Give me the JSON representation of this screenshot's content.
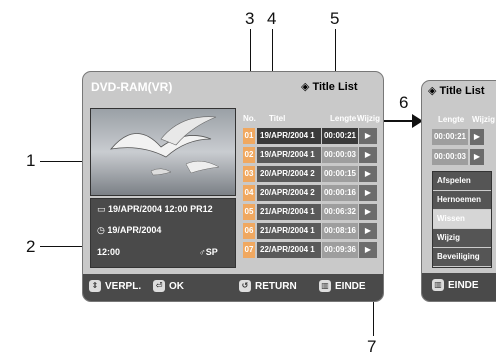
{
  "callouts": {
    "c1": "1",
    "c2": "2",
    "c3": "3",
    "c4": "4",
    "c5": "5",
    "c6": "6",
    "c7": "7"
  },
  "panel": {
    "title": "DVD-RAM(VR)",
    "title_list_label": "Title List",
    "columns": {
      "no": "No.",
      "titel": "Titel",
      "lengte": "Lengte",
      "wijzig": "Wijzig"
    },
    "info": {
      "line1": "19/APR/2004 12:00 PR12",
      "line2": "19/APR/2004",
      "line3_time": "12:00",
      "line3_mode": "SP"
    },
    "rows": [
      {
        "num": "01",
        "title": "19/APR/2004 1",
        "length": "00:00:21",
        "selected": true
      },
      {
        "num": "02",
        "title": "19/APR/2004 1",
        "length": "00:00:03"
      },
      {
        "num": "03",
        "title": "20/APR/2004 2",
        "length": "00:00:15"
      },
      {
        "num": "04",
        "title": "20/APR/2004 2",
        "length": "00:00:16"
      },
      {
        "num": "05",
        "title": "21/APR/2004 1",
        "length": "00:06:32"
      },
      {
        "num": "06",
        "title": "21/APR/2004 1",
        "length": "00:08:16"
      },
      {
        "num": "07",
        "title": "22/APR/2004 1",
        "length": "00:09:36"
      }
    ],
    "buttons": {
      "move": "VERPL.",
      "ok": "OK",
      "return": "RETURN",
      "exit": "EINDE"
    }
  },
  "panel2": {
    "title_list_label": "Title List",
    "columns": {
      "lengte": "Lengte",
      "wijzig": "Wijzig"
    },
    "rows": [
      {
        "length": "00:00:21"
      },
      {
        "length": "00:00:03"
      }
    ],
    "menu": [
      "Afspelen",
      "Hernoemen",
      "Wissen",
      "Wijzig",
      "Beveiliging"
    ],
    "menu_highlight_index": 2,
    "exit": "EINDE"
  }
}
